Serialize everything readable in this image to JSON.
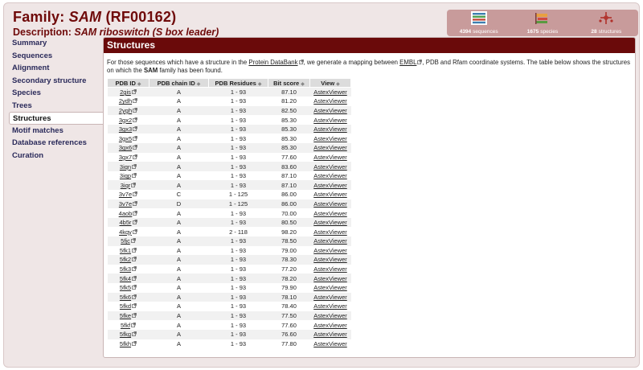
{
  "header": {
    "family_prefix": "Family:",
    "family_name": "SAM",
    "family_acc": "(RF00162)",
    "desc_prefix": "Description:",
    "desc_text": "SAM riboswitch (S box leader)"
  },
  "stats": [
    {
      "icon": "sequences-icon",
      "count": "4394",
      "label": "sequences"
    },
    {
      "icon": "species-icon",
      "count": "1675",
      "label": "species"
    },
    {
      "icon": "structures-icon",
      "count": "28",
      "label": "structures"
    }
  ],
  "sidebar": {
    "items": [
      {
        "label": "Summary",
        "active": false
      },
      {
        "label": "Sequences",
        "active": false
      },
      {
        "label": "Alignment",
        "active": false
      },
      {
        "label": "Secondary structure",
        "active": false
      },
      {
        "label": "Species",
        "active": false
      },
      {
        "label": "Trees",
        "active": false
      },
      {
        "label": "Structures",
        "active": true
      },
      {
        "label": "Motif matches",
        "active": false
      },
      {
        "label": "Database references",
        "active": false
      },
      {
        "label": "Curation",
        "active": false
      }
    ]
  },
  "panel": {
    "title": "Structures",
    "intro_1": "For those sequences which have a structure in the ",
    "intro_link_pdb": "Protein DataBank",
    "intro_2": ", we generate a mapping between ",
    "intro_link_embl": "EMBL",
    "intro_3": ", PDB and Rfam coordinate systems. The table below shows the structures on which the ",
    "intro_family": "SAM",
    "intro_4": " family has been found."
  },
  "table": {
    "columns": [
      "PDB ID",
      "PDB chain ID",
      "PDB Residues",
      "Bit score",
      "View"
    ],
    "rows": [
      [
        "2gis",
        "A",
        "1 - 93",
        "87.10",
        "AstexViewer"
      ],
      [
        "2ydh",
        "A",
        "1 - 93",
        "81.20",
        "AstexViewer"
      ],
      [
        "2ygh",
        "A",
        "1 - 93",
        "82.50",
        "AstexViewer"
      ],
      [
        "3gx2",
        "A",
        "1 - 93",
        "85.30",
        "AstexViewer"
      ],
      [
        "3gx3",
        "A",
        "1 - 93",
        "85.30",
        "AstexViewer"
      ],
      [
        "3gx5",
        "A",
        "1 - 93",
        "85.30",
        "AstexViewer"
      ],
      [
        "3gx6",
        "A",
        "1 - 93",
        "85.30",
        "AstexViewer"
      ],
      [
        "3gx7",
        "A",
        "1 - 93",
        "77.60",
        "AstexViewer"
      ],
      [
        "3iqn",
        "A",
        "1 - 93",
        "83.60",
        "AstexViewer"
      ],
      [
        "3iqp",
        "A",
        "1 - 93",
        "87.10",
        "AstexViewer"
      ],
      [
        "3iqr",
        "A",
        "1 - 93",
        "87.10",
        "AstexViewer"
      ],
      [
        "3v7e",
        "C",
        "1 - 125",
        "86.00",
        "AstexViewer"
      ],
      [
        "3v7e",
        "D",
        "1 - 125",
        "86.00",
        "AstexViewer"
      ],
      [
        "4aob",
        "A",
        "1 - 93",
        "70.00",
        "AstexViewer"
      ],
      [
        "4b5r",
        "A",
        "1 - 93",
        "80.50",
        "AstexViewer"
      ],
      [
        "4kqy",
        "A",
        "2 - 118",
        "98.20",
        "AstexViewer"
      ],
      [
        "5fjc",
        "A",
        "1 - 93",
        "78.50",
        "AstexViewer"
      ],
      [
        "5fk1",
        "A",
        "1 - 93",
        "79.00",
        "AstexViewer"
      ],
      [
        "5fk2",
        "A",
        "1 - 93",
        "78.30",
        "AstexViewer"
      ],
      [
        "5fk3",
        "A",
        "1 - 93",
        "77.20",
        "AstexViewer"
      ],
      [
        "5fk4",
        "A",
        "1 - 93",
        "78.20",
        "AstexViewer"
      ],
      [
        "5fk5",
        "A",
        "1 - 93",
        "79.90",
        "AstexViewer"
      ],
      [
        "5fk6",
        "A",
        "1 - 93",
        "78.10",
        "AstexViewer"
      ],
      [
        "5fkd",
        "A",
        "1 - 93",
        "78.40",
        "AstexViewer"
      ],
      [
        "5fke",
        "A",
        "1 - 93",
        "77.50",
        "AstexViewer"
      ],
      [
        "5fkf",
        "A",
        "1 - 93",
        "77.60",
        "AstexViewer"
      ],
      [
        "5fkg",
        "A",
        "1 - 93",
        "76.60",
        "AstexViewer"
      ],
      [
        "5fkh",
        "A",
        "1 - 93",
        "77.80",
        "AstexViewer"
      ]
    ]
  },
  "colors": {
    "brand": "#6a0a0a",
    "frame_bg": "#efe6e6",
    "stats_bg": "#c89b9b"
  }
}
